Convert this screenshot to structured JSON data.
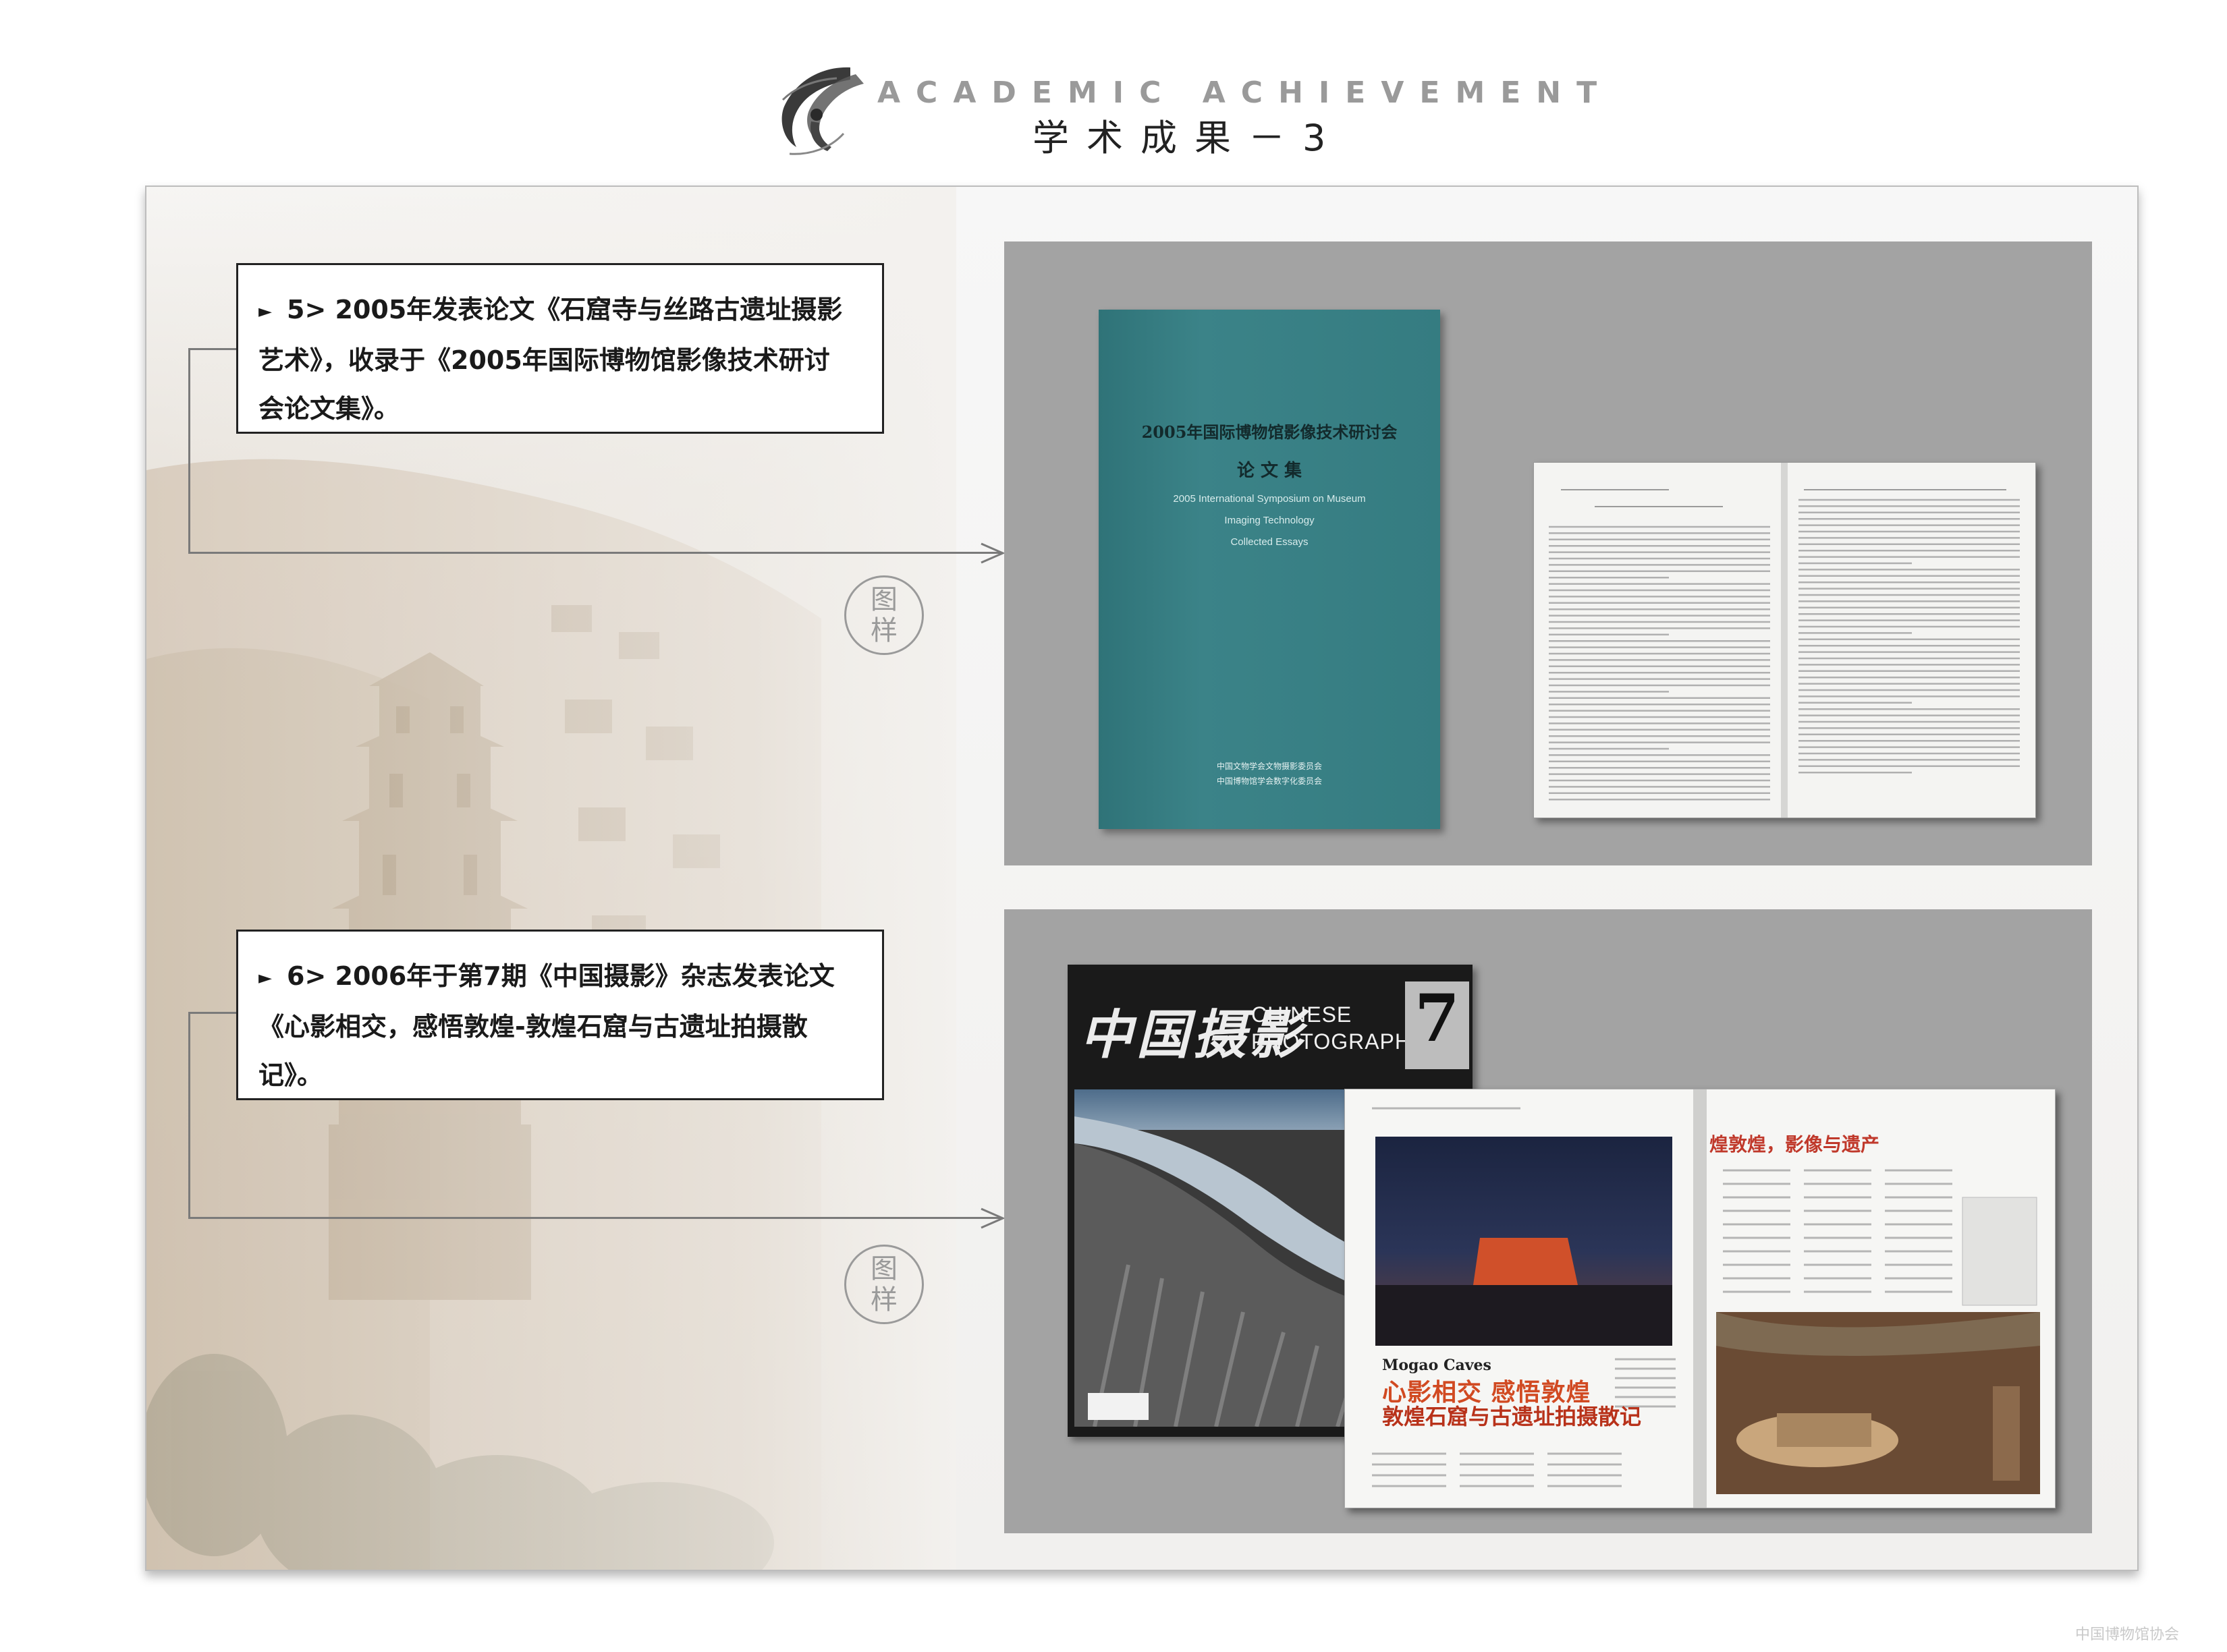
{
  "header": {
    "title_en": "ACADEMIC ACHIEVEMENT",
    "title_cn": "学术成果－3"
  },
  "items": [
    {
      "bullet": "►",
      "text": "5> 2005年发表论文《石窟寺与丝路古遗址摄影艺术》，收录于《2005年国际博物馆影像技术研讨会论文集》。",
      "line1": "5> 2005年发表论文《石窟寺与丝路古遗址摄影",
      "line2": "艺术》，收录于《2005年国际博物馆影像技术研讨",
      "line3": "会论文集》。",
      "stamp_top": "图",
      "stamp_bottom": "样"
    },
    {
      "bullet": "►",
      "text": "6> 2006年于第7期《中国摄影》杂志发表论文《心影相交，感悟敦煌-敦煌石窟与古遗址拍摄散记》。",
      "line1": "6> 2006年于第7期《中国摄影》杂志发表论文",
      "line2": "《心影相交，感悟敦煌-敦煌石窟与古遗址拍摄散",
      "line3": "记》。",
      "stamp_top": "图",
      "stamp_bottom": "样"
    }
  ],
  "book_cover": {
    "title_cn": "2005年国际博物馆影像技术研讨会",
    "subtitle_cn": "论 文 集",
    "title_en_1": "2005 International Symposium on Museum",
    "title_en_2": "Imaging Technology",
    "title_en_3": "Collected Essays",
    "publisher_1": "中国文物学会文物摄影委员会",
    "publisher_2": "中国博物馆学会数字化委员会",
    "color": "#3a8287"
  },
  "magazine_cover": {
    "title_cn": "中国摄影",
    "title_en_1": "CHINESE",
    "title_en_2": "PHOTOGRAPHY",
    "issue": "7"
  },
  "magazine_spread": {
    "title_en": "Mogao Caves",
    "title_cn_1": "心影相交 感悟敦煌",
    "title_cn_2": "敦煌石窟与古遗址拍摄散记",
    "right_title": "煌敦煌，影像与遗产"
  },
  "watermark": "中国博物馆协会"
}
